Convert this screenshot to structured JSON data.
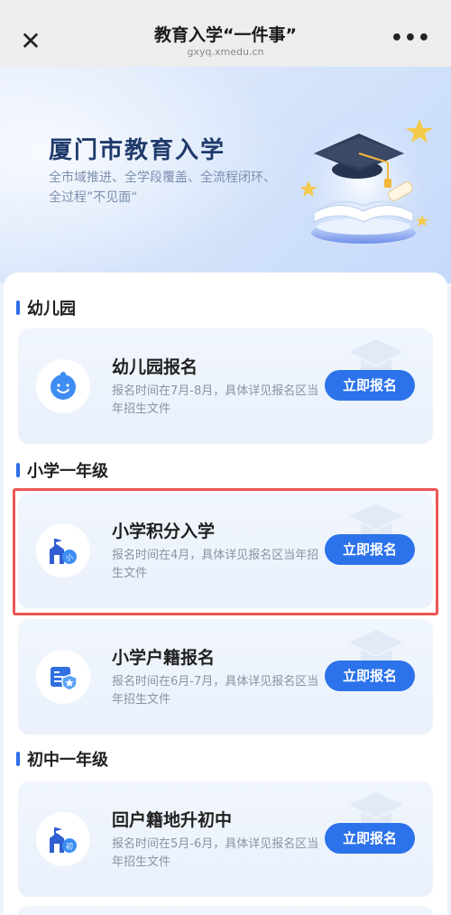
{
  "navbar": {
    "close_icon": "close-icon",
    "title": "教育入学“一件事”",
    "domain": "gxyq.xmedu.cn",
    "more_icon": "more-icon",
    "more_glyph": "•••"
  },
  "hero": {
    "title": "厦门市教育入学",
    "subtitle_line1": "全市域推进、全学段覆盖、全流程闭环、",
    "subtitle_line2": "全过程”不见面“"
  },
  "sections": [
    {
      "header": "幼儿园",
      "cards": [
        {
          "title": "幼儿园报名",
          "description": "报名时间在7月-8月，具体详见报名区当年招生文件",
          "button": "立即报名",
          "icon": "baby-face-icon"
        }
      ]
    },
    {
      "header": "小学一年级",
      "cards": [
        {
          "title": "小学积分入学",
          "description": "报名时间在4月，具体详见报名区当年招生文件",
          "button": "立即报名",
          "icon": "school-building-icon",
          "icon_badge": "小"
        },
        {
          "title": "小学户籍报名",
          "description": "报名时间在6月-7月，具体详见报名区当年招生文件",
          "button": "立即报名",
          "icon": "household-register-icon"
        }
      ]
    },
    {
      "header": "初中一年级",
      "cards": [
        {
          "title": "回户籍地升初中",
          "description": "报名时间在5月-6月，具体详见报名区当年招生文件",
          "button": "立即报名",
          "icon": "school-building-icon",
          "icon_badge": "初"
        }
      ]
    }
  ],
  "colors": {
    "accent": "#2c72ea",
    "highlight": "#ee5555",
    "title_text": "#1f3a6b"
  }
}
